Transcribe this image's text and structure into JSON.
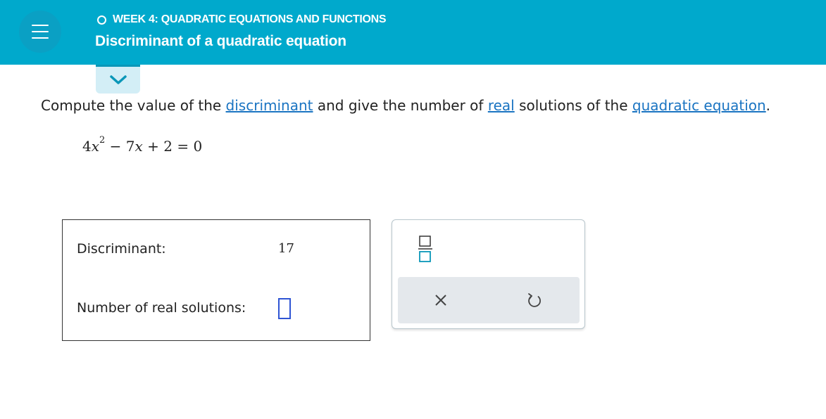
{
  "header": {
    "topic": "WEEK 4: QUADRATIC EQUATIONS AND FUNCTIONS",
    "title": "Discriminant of a quadratic equation",
    "background_color": "#00a9cc"
  },
  "icons": {
    "menu": "hamburger-menu-icon",
    "topic_status": "circle-outline-icon",
    "toggle": "chevron-down-icon",
    "fraction": "fraction-icon",
    "clear": "x-close-icon",
    "undo": "undo-arrow-icon"
  },
  "problem": {
    "prompt_before": "Compute the value of the ",
    "link_discriminant": "discriminant",
    "prompt_middle": " and give the number of ",
    "link_real": "real",
    "prompt_after": " solutions of the ",
    "link_quadratic": "quadratic equation",
    "prompt_end": ".",
    "equation": {
      "coef_a": "4",
      "var": "x",
      "exponent": "2",
      "op1": "−",
      "coef_b": "7",
      "op2": "+",
      "constant": "2",
      "equals": "=",
      "rhs": "0"
    }
  },
  "answer": {
    "discriminant_label": "Discriminant:",
    "discriminant_value": "17",
    "num_solutions_label": "Number of real solutions:",
    "num_solutions_value": ""
  },
  "colors": {
    "link": "#1a74c2",
    "input_border": "#2f55d4",
    "icon_teal": "#0a97b8"
  }
}
